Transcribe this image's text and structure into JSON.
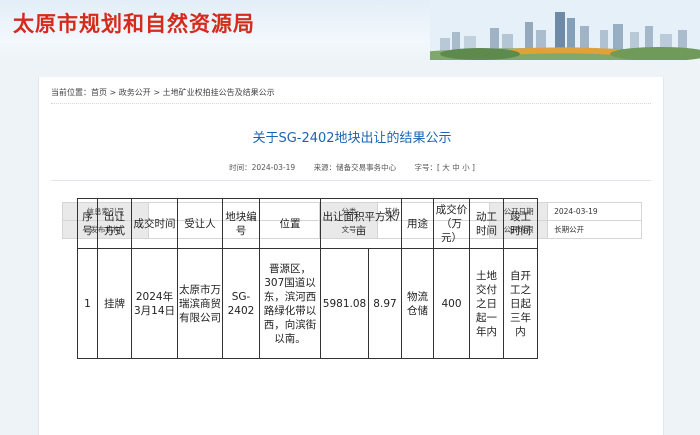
{
  "site": {
    "title": "太原市规划和自然资源局"
  },
  "breadcrumb": {
    "prefix": "当前位置：",
    "items": [
      "首页",
      "政务公开",
      "土地矿业权拍挂公告及结果公示"
    ],
    "sep": " > "
  },
  "article": {
    "title": "关于SG-2402地块出让的结果公示",
    "time_label": "时间：",
    "time": "2024-03-19",
    "source_label": "来源：",
    "source": "储备交易事务中心",
    "fontsize_label": "字号：",
    "font_open": "[",
    "font_large": "大",
    "font_mid": "中",
    "font_small": "小",
    "font_close": "]"
  },
  "info": {
    "index_label": "信息索引号",
    "index": "",
    "category_label": "分类",
    "category": "其他",
    "pubdate_label": "公开日期",
    "pubdate": "2024-03-19",
    "org_label": "发布机构",
    "org": "",
    "docno_label": "文号",
    "docno": "",
    "period_label": "公开时限",
    "period": "长期公开"
  },
  "result": {
    "headers": [
      "序号",
      "出让方式",
      "成交时间",
      "受让人",
      "地块编号",
      "位置",
      "出让面积平方米/亩",
      "用途",
      "成交价（万元）",
      "动工时间",
      "竣工时间"
    ],
    "row": {
      "no": "1",
      "method": "挂牌",
      "date": "2024年3月14日",
      "buyer": "太原市万瑞滨商贸有限公司",
      "parcel": "SG-2402",
      "location": "晋源区，307国道以东，滨河西路绿化带以西，向滨街以南。",
      "area_m2": "5981.08",
      "area_mu": "8.97",
      "use": "物流仓储",
      "price": "400",
      "start": "土地交付之日起一年内",
      "finish": "自开工之日起三年内"
    }
  },
  "colors": {
    "title_red": "#d42b1c",
    "title_blue": "#1b64b4"
  }
}
